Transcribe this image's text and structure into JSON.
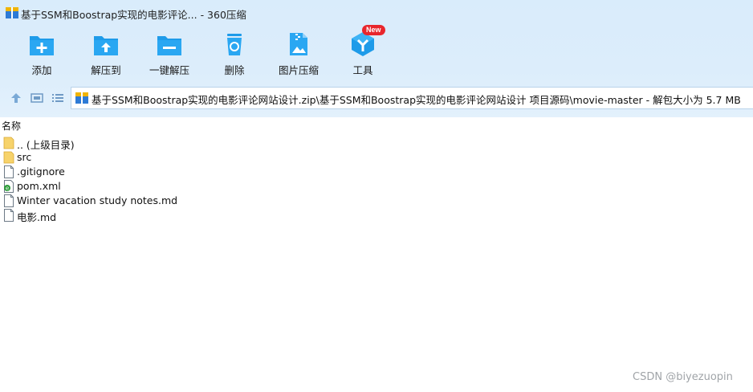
{
  "window": {
    "title": "基于SSM和Boostrap实现的电影评论... - 360压缩"
  },
  "toolbar": {
    "items": [
      {
        "label": "添加",
        "icon": "add-icon"
      },
      {
        "label": "解压到",
        "icon": "extract-to-icon"
      },
      {
        "label": "一键解压",
        "icon": "one-click-extract-icon"
      },
      {
        "label": "删除",
        "icon": "delete-icon"
      },
      {
        "label": "图片压缩",
        "icon": "image-compress-icon"
      },
      {
        "label": "工具",
        "icon": "tools-icon",
        "badge": "New"
      }
    ]
  },
  "nav": {
    "address": "基于SSM和Boostrap实现的电影评论网站设计.zip\\基于SSM和Boostrap实现的电影评论网站设计 项目源码\\movie-master - 解包大小为 5.7 MB"
  },
  "list": {
    "column_name": "名称",
    "files": [
      {
        "name": ".. (上级目录)",
        "type": "folder"
      },
      {
        "name": "src",
        "type": "folder"
      },
      {
        "name": ".gitignore",
        "type": "file"
      },
      {
        "name": "pom.xml",
        "type": "xml"
      },
      {
        "name": "Winter vacation study notes.md",
        "type": "file"
      },
      {
        "name": "电影.md",
        "type": "file"
      }
    ]
  },
  "watermark": "CSDN @biyezuopin",
  "colors": {
    "accent": "#1e9be9",
    "toolbar_bg": "#d9ecfb",
    "badge": "#e8262c"
  }
}
